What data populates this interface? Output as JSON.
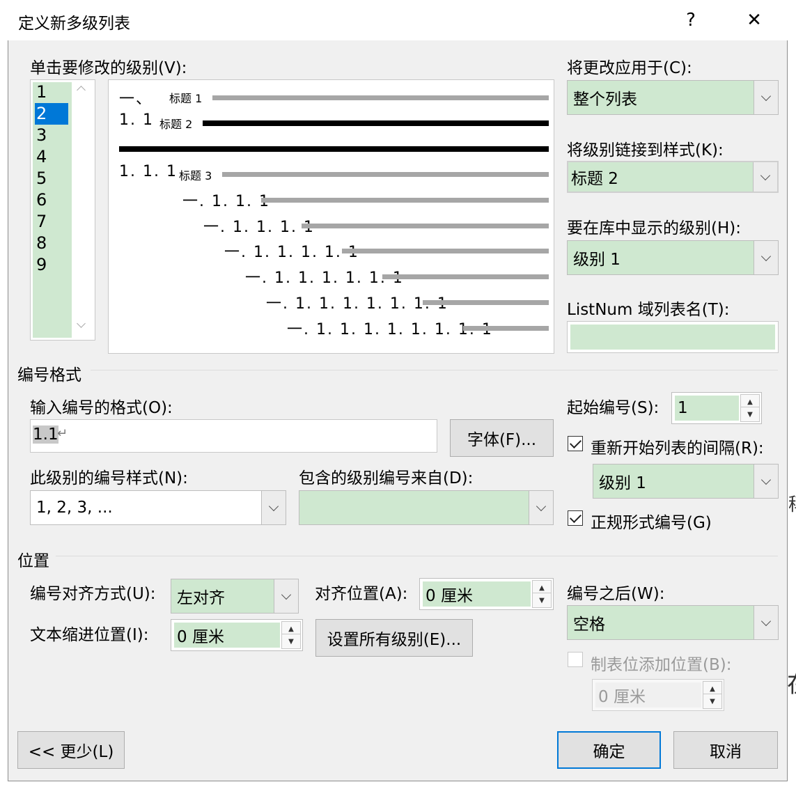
{
  "title": "定义新多级列表",
  "title_help": "?",
  "title_close": "✕",
  "level_label": "单击要修改的级别(V):",
  "levels": [
    "1",
    "2",
    "3",
    "4",
    "5",
    "6",
    "7",
    "8",
    "9"
  ],
  "selected_level": "2",
  "preview": {
    "row1_num": "一、",
    "row1_text": "标题 1",
    "row2_num": "1. 1",
    "row2_text": "标题 2",
    "row3_num": "1. 1. 1",
    "row3_text": "标题 3",
    "row4_num": "一. 1. 1. 1",
    "row5_num": "一. 1. 1. 1. 1",
    "row6_num": "一. 1. 1. 1. 1. 1",
    "row7_num": "一. 1. 1. 1. 1. 1. 1",
    "row8_num": "一. 1. 1. 1. 1. 1. 1. 1",
    "row9_num": "一. 1. 1. 1. 1. 1. 1. 1. 1"
  },
  "apply_to": {
    "label": "将更改应用于(C):",
    "value": "整个列表"
  },
  "link_style": {
    "label": "将级别链接到样式(K):",
    "value": "标题 2"
  },
  "gallery_level": {
    "label": "要在库中显示的级别(H):",
    "value": "级别 1"
  },
  "listnum": {
    "label": "ListNum 域列表名(T):",
    "value": ""
  },
  "number_format_section": "编号格式",
  "enter_format": {
    "label": "输入编号的格式(O):",
    "value": "1.1",
    "para_mark": "↵"
  },
  "font_button": "字体(F)...",
  "start_at": {
    "label": "起始编号(S):",
    "value": "1"
  },
  "restart": {
    "label": "重新开始列表的间隔(R):",
    "checked": true,
    "value": "级别 1"
  },
  "legal": {
    "label": "正规形式编号(G)",
    "checked": true
  },
  "number_style": {
    "label": "此级别的编号样式(N):",
    "value": "1, 2, 3, ..."
  },
  "include_level": {
    "label": "包含的级别编号来自(D):",
    "value": ""
  },
  "position_section": "位置",
  "alignment": {
    "label": "编号对齐方式(U):",
    "value": "左对齐"
  },
  "aligned_at": {
    "label": "对齐位置(A):",
    "value": "0 厘米"
  },
  "indent_at": {
    "label": "文本缩进位置(I):",
    "value": "0 厘米"
  },
  "set_all_button": "设置所有级别(E)...",
  "follow_with": {
    "label": "编号之后(W):",
    "value": "空格"
  },
  "tab_stop": {
    "label": "制表位添加位置(B):",
    "checked": false,
    "value": "0 厘米"
  },
  "less_button": "<< 更少(L)",
  "ok_button": "确定",
  "cancel_button": "取消",
  "bg_glyph_1": "稱",
  "bg_glyph_2": "在",
  "colors": {
    "field_green": "#cfe8d0",
    "selection_blue": "#0078d7",
    "dialog_bg": "#f0f0f0"
  }
}
